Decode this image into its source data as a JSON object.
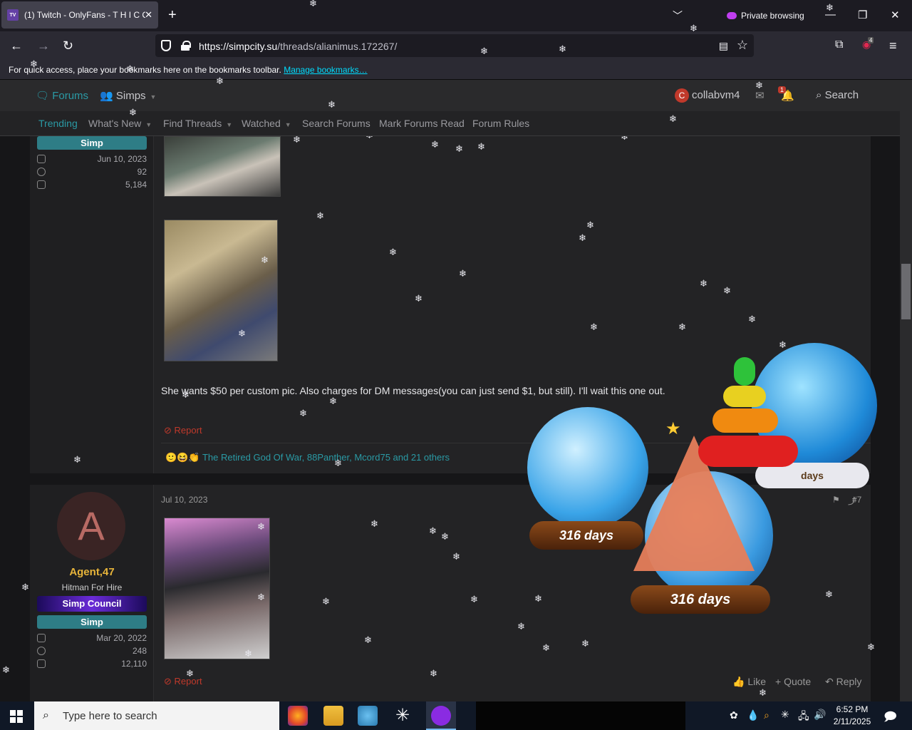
{
  "browser": {
    "tab_title": "(1) Twitch - OnlyFans - T H I C C",
    "tab_favicon": "twitch",
    "private_label": "Private browsing",
    "url_host": "https://simpcity.su",
    "url_path": "/threads/alianimus.172267/",
    "bookmarks_text": "For quick access, place your bookmarks here on the bookmarks toolbar.",
    "bookmarks_link": "Manage bookmarks…",
    "ext_badge": "4"
  },
  "site": {
    "nav_forums": "Forums",
    "nav_simps": "Simps",
    "user_initial": "C",
    "username": "collabvm4",
    "alert_count": "1",
    "search_label": "Search",
    "subnav": [
      "Trending",
      "What's New",
      "Find Threads",
      "Watched",
      "Search Forums",
      "Mark Forums Read",
      "Forum Rules"
    ]
  },
  "post1": {
    "badge": "Simp",
    "joined": "Jun 10, 2023",
    "messages": "92",
    "reactions": "5,184",
    "text": "She wants $50 per custom pic. Also charges for DM messages(you can just send $1, but still). I'll wait this one out.",
    "report": "Report",
    "likes_text": "The Retired God Of War, 88Panther, Mcord75 and 21 others"
  },
  "post2": {
    "avatar_letter": "A",
    "username": "Agent,47",
    "title": "Hitman For Hire",
    "council_badge": "Simp Council",
    "badge": "Simp",
    "joined": "Mar 20, 2022",
    "messages": "248",
    "reactions": "12,110",
    "date": "Jul 10, 2023",
    "post_number": "#7",
    "report": "Report",
    "like": "Like",
    "quote": "+ Quote",
    "reply": "Reply"
  },
  "overlay": {
    "globe_text": "316 days",
    "globe_text_2": "316 days",
    "globe_text_3": "days"
  },
  "taskbar": {
    "search_placeholder": "Type here to search",
    "time": "6:52 PM",
    "date": "2/11/2025"
  },
  "colors": {
    "accent": "#2a9aa5",
    "report": "#c0392b",
    "council": "#3b1b8c",
    "username_gold": "#e7b43a"
  }
}
